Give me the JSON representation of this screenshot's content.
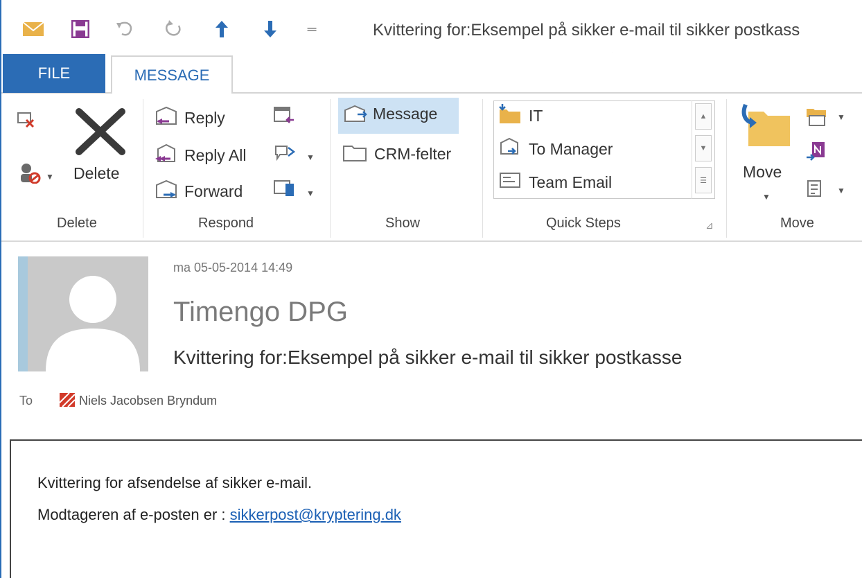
{
  "window": {
    "title": "Kvittering for:Eksempel på sikker e-mail til sikker postkass"
  },
  "quick_access": [
    {
      "name": "mail-icon"
    },
    {
      "name": "save-icon"
    },
    {
      "name": "undo-icon"
    },
    {
      "name": "redo-icon"
    },
    {
      "name": "previous-item-icon"
    },
    {
      "name": "next-item-icon"
    },
    {
      "name": "customize-toolbar-icon"
    }
  ],
  "tabs": {
    "file": "FILE",
    "message": "MESSAGE"
  },
  "ribbon": {
    "delete_group": {
      "label": "Delete",
      "delete_button": "Delete"
    },
    "respond_group": {
      "label": "Respond",
      "reply": "Reply",
      "reply_all": "Reply All",
      "forward": "Forward"
    },
    "show_group": {
      "label": "Show",
      "message": "Message",
      "crm": "CRM-felter"
    },
    "quick_steps_group": {
      "label": "Quick Steps",
      "items": [
        "IT",
        "To Manager",
        "Team Email"
      ]
    },
    "move_group": {
      "label": "Move",
      "move_button": "Move"
    }
  },
  "message": {
    "timestamp": "ma 05-05-2014 14:49",
    "sender": "Timengo DPG",
    "subject": "Kvittering for:Eksempel på sikker e-mail til sikker postkasse",
    "to_label": "To",
    "recipient": "Niels Jacobsen Bryndum",
    "body_line1": "Kvittering for afsendelse af sikker e-mail.",
    "body_line2_prefix": "Modtageren af e-posten er : ",
    "body_link": "sikkerpost@kryptering.dk"
  },
  "colors": {
    "accent": "#2b6cb5",
    "link": "#1a5fb4",
    "selected": "#cde2f4"
  }
}
